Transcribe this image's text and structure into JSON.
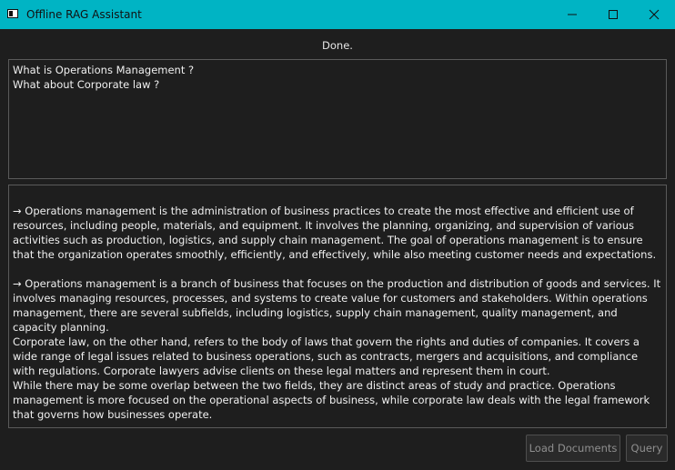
{
  "window": {
    "title": "Offline RAG Assistant"
  },
  "status": {
    "text": "Done."
  },
  "query": {
    "lines": [
      "What is Operations Management ?",
      "What about Corporate law ?"
    ]
  },
  "answer": {
    "paragraphs": [
      "→ Operations management is the administration of business practices to create the most effective and efficient use of resources, including people, materials, and equipment. It involves the planning, organizing, and supervision of various activities such as production, logistics, and supply chain management. The goal of operations management is to ensure that the organization operates smoothly, efficiently, and effectively, while also meeting customer needs and expectations.",
      "→ Operations management is a branch of business that focuses on the production and distribution of goods and services. It involves managing resources, processes, and systems to create value for customers and stakeholders. Within operations management, there are several subfields, including logistics, supply chain management, quality management, and capacity planning.",
      "Corporate law, on the other hand, refers to the body of laws that govern the rights and duties of companies. It covers a wide range of legal issues related to business operations, such as contracts, mergers and acquisitions, and compliance with regulations. Corporate lawyers advise clients on these legal matters and represent them in court.",
      "While there may be some overlap between the two fields, they are distinct areas of study and practice. Operations management is more focused on the operational aspects of business, while corporate law deals with the legal framework that governs how businesses operate."
    ]
  },
  "buttons": {
    "load_documents": "Load Documents",
    "query": "Query"
  },
  "colors": {
    "titlebar": "#00b4c4",
    "background": "#1e1e1e",
    "text": "#f0f0f0",
    "border": "#5a5a5a",
    "button_disabled_text": "#8f8f8f"
  },
  "icons": {
    "app": "app-window-icon",
    "minimize": "minimize-icon",
    "maximize": "maximize-icon",
    "close": "close-icon"
  }
}
